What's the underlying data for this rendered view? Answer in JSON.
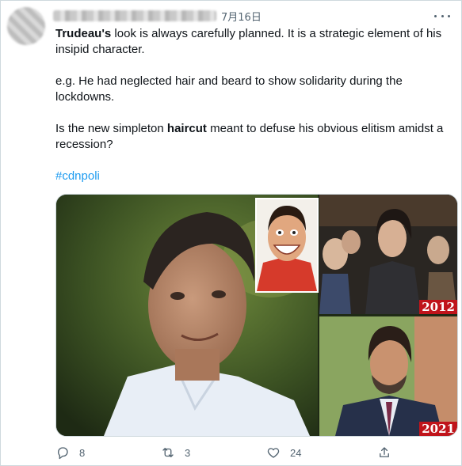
{
  "tweet": {
    "date": "7月16日",
    "paragraphs": {
      "p1": {
        "bold": "Trudeau's",
        "rest": " look is always carefully planned. It is a strategic element of his insipid character."
      },
      "p2": {
        "text": "e.g. He had neglected hair and beard to show solidarity during the lockdowns."
      },
      "p3": {
        "before": "Is the new simpleton ",
        "bold": "haircut",
        "after": " meant to defuse his obvious elitism amidst a recession?"
      }
    },
    "hashtag": "#cdnpoli"
  },
  "media": {
    "badge_2012": "2012",
    "badge_2021": "2021"
  },
  "actions": {
    "reply_count": "8",
    "retweet_count": "3",
    "like_count": "24"
  },
  "icons": [
    "more-icon",
    "reply-icon",
    "retweet-icon",
    "like-icon",
    "share-icon"
  ],
  "colors": {
    "link": "#1d9bf0",
    "muted": "#536471",
    "badge": "#c0141b"
  }
}
